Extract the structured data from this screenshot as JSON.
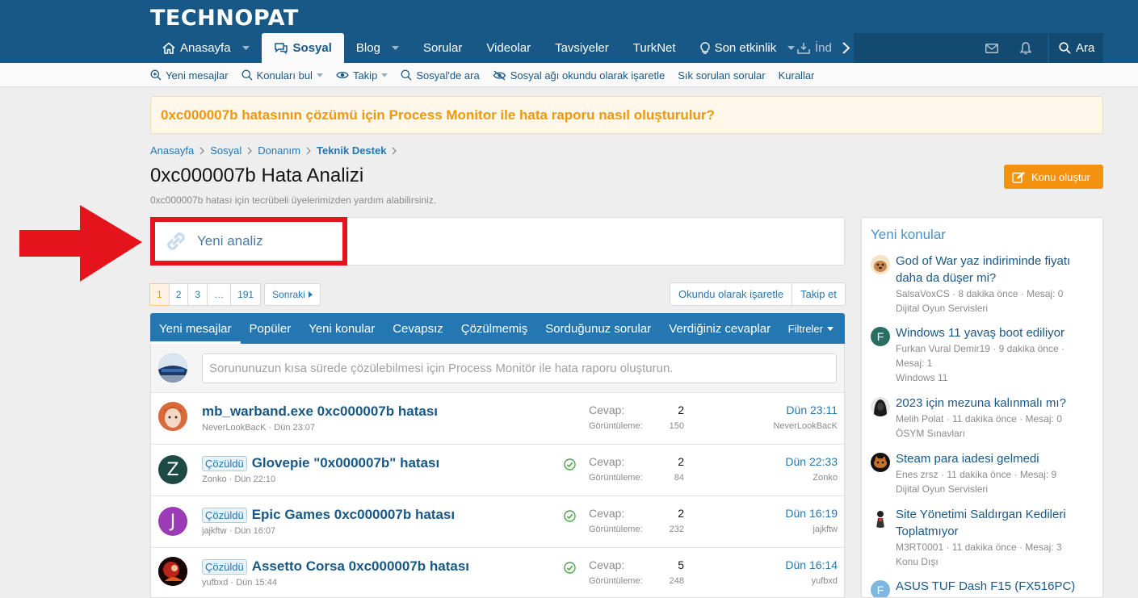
{
  "header": {
    "logo": "TECHNOPAT",
    "nav": [
      {
        "label": "Anasayfa",
        "icon": "home-icon",
        "dropdown": true
      },
      {
        "label": "Sosyal",
        "icon": "chat-icon",
        "active": true
      },
      {
        "label": "Blog",
        "dropdown": true
      },
      {
        "label": "Sorular"
      },
      {
        "label": "Videolar"
      },
      {
        "label": "Tavsiyeler"
      },
      {
        "label": "TurkNet"
      },
      {
        "label": "Son etkinlik",
        "icon": "bulb-icon",
        "dropdown": true
      }
    ],
    "nav_clipped": "İnd",
    "search_label": "Ara"
  },
  "subnav": [
    {
      "label": "Yeni mesajlar",
      "icon": "search-plus-icon"
    },
    {
      "label": "Konuları bul",
      "icon": "search-icon",
      "dropdown": true
    },
    {
      "label": "Takip",
      "icon": "eye-icon",
      "dropdown": true
    },
    {
      "label": "Sosyal'de ara",
      "icon": "search-icon"
    },
    {
      "label": "Sosyal ağı okundu olarak işaretle",
      "icon": "eye-slash-icon"
    },
    {
      "label": "Sık sorulan sorular"
    },
    {
      "label": "Kurallar"
    }
  ],
  "notice": "0xc000007b hatasının çözümü için Process Monitor ile hata raporu nasıl oluşturulur?",
  "breadcrumb": [
    "Anasayfa",
    "Sosyal",
    "Donanım",
    "Teknik Destek"
  ],
  "page": {
    "title": "0xc000007b Hata Analizi",
    "description": "0xc000007b hatası için tecrübeli üyelerimizden yardım alabilirsiniz.",
    "create_button": "Konu oluştur"
  },
  "link_box": "Yeni analiz",
  "pager": {
    "pages": [
      "1",
      "2",
      "3",
      "…",
      "191"
    ],
    "next": "Sonraki"
  },
  "actions": {
    "mark_read": "Okundu olarak işaretle",
    "follow": "Takip et"
  },
  "tabs": [
    "Yeni mesajlar",
    "Popüler",
    "Yeni konular",
    "Cevapsız",
    "Çözülmemiş",
    "Sorduğunuz sorular",
    "Verdiğiniz cevaplar"
  ],
  "filters_label": "Filtreler",
  "quick_thread_placeholder": "Sorununuzun kısa sürede çözülebilmesi için Process Monitör ile hata raporu oluşturun.",
  "stat_labels": {
    "replies": "Cevap:",
    "views": "Görüntüleme:"
  },
  "threads": [
    {
      "badge": "",
      "title": "mb_warband.exe 0xc000007b hatası",
      "author": "NeverLookBacK",
      "date": "Dün 23:07",
      "replies": "2",
      "views": "150",
      "last_date": "Dün 23:11",
      "last_user": "NeverLookBacK",
      "solved": false,
      "avatar": "anime-avatar"
    },
    {
      "badge": "Çözüldü",
      "title": "Glovepie \"0x000007b\" hatası",
      "author": "Zonko",
      "date": "Dün 22:10",
      "replies": "2",
      "views": "84",
      "last_date": "Dün 22:33",
      "last_user": "Zonko",
      "solved": true,
      "avatar": "Z",
      "avatar_color": "#1e4a46"
    },
    {
      "badge": "Çözüldü",
      "title": "Epic Games 0xc000007b hatası",
      "author": "jajkftw",
      "date": "Dün 16:07",
      "replies": "2",
      "views": "232",
      "last_date": "Dün 16:19",
      "last_user": "jajkftw",
      "solved": true,
      "avatar": "J",
      "avatar_color": "#9b3bb5"
    },
    {
      "badge": "Çözüldü",
      "title": "Assetto Corsa 0xc000007b hatası",
      "author": "yufbxd",
      "date": "Dün 15:44",
      "replies": "5",
      "views": "248",
      "last_date": "Dün 16:14",
      "last_user": "yufbxd",
      "solved": true,
      "avatar": "dark-avatar"
    }
  ],
  "sidebar": {
    "title": "Yeni konular",
    "items": [
      {
        "title_lines": [
          "God of War yaz indiriminde fiyatı",
          "daha da düşer mi?"
        ],
        "meta_lines": [
          "SalsaVoxCS · 8 dakika önce · Mesaj: 0",
          "Dijital Oyun Servisleri"
        ],
        "avatar": "dog-avatar"
      },
      {
        "title_lines": [
          "Windows 11 yavaş boot ediliyor"
        ],
        "meta_lines": [
          "Furkan Vural Demir19 · 9 dakika önce ·",
          "Mesaj: 1",
          "Windows 11"
        ],
        "avatar": "F",
        "avatar_color": "#2a6e63"
      },
      {
        "title_lines": [
          "2023 için mezuna kalınmalı mı?"
        ],
        "meta_lines": [
          "Melih Polat · 11 dakika önce · Mesaj: 0",
          "ÖSYM Sınavları"
        ],
        "avatar": "hood-avatar"
      },
      {
        "title_lines": [
          "Steam para iadesi gelmedi"
        ],
        "meta_lines": [
          "Enes zrsz · 11 dakika önce · Mesaj: 9",
          "Dijital Oyun Servisleri"
        ],
        "avatar": "cat-avatar"
      },
      {
        "title_lines": [
          "Site Yönetimi Saldırgan Kedileri",
          "Toplatmıyor"
        ],
        "meta_lines": [
          "M3RT0001 · 11 dakika önce · Mesaj: 3",
          "Konu Dışı"
        ],
        "avatar": "figure-avatar"
      },
      {
        "title_lines": [
          "ASUS TUF Dash F15 (FX516PC)"
        ],
        "meta_lines": [],
        "avatar": "F",
        "avatar_color": "#7fb7e0"
      }
    ]
  }
}
